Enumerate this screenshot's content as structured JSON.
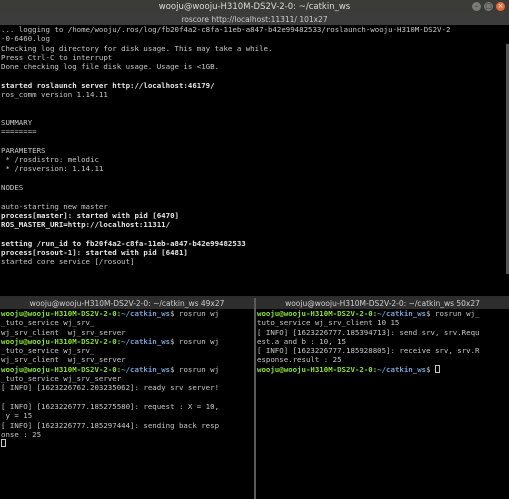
{
  "window_title": "wooju@wooju-H310M-DS2V-2-0: ~/catkin_ws",
  "window_controls": {
    "minimize": "–",
    "maximize": "□",
    "close": "×"
  },
  "top_pane": {
    "title": "roscore http://localhost:11311/ 101x27",
    "lines": [
      {
        "t": "... logging to /home/wooju/.ros/log/fb20f4a2-c8fa-11eb-a847-b42e99482533/roslaunch-wooju-H310M-DS2V-2"
      },
      {
        "t": "-0-6460.log"
      },
      {
        "t": "Checking log directory for disk usage. This may take a while."
      },
      {
        "t": "Press Ctrl-C to interrupt"
      },
      {
        "t": "Done checking log file disk usage. Usage is <1GB."
      },
      {
        "t": ""
      },
      {
        "t": "started roslaunch server http://localhost:46179/",
        "b": true
      },
      {
        "t": "ros_comm version 1.14.11"
      },
      {
        "t": ""
      },
      {
        "t": ""
      },
      {
        "t": "SUMMARY"
      },
      {
        "t": "========"
      },
      {
        "t": ""
      },
      {
        "t": "PARAMETERS"
      },
      {
        "t": " * /rosdistro: melodic"
      },
      {
        "t": " * /rosversion: 1.14.11"
      },
      {
        "t": ""
      },
      {
        "t": "NODES"
      },
      {
        "t": ""
      },
      {
        "t": "auto-starting new master"
      },
      {
        "t": "process[master]: started with pid [6470]",
        "b": true
      },
      {
        "t": "ROS_MASTER_URI=http://localhost:11311/",
        "b": true
      },
      {
        "t": ""
      },
      {
        "t": "setting /run_id to fb20f4a2-c8fa-11eb-a847-b42e99482533",
        "b": true
      },
      {
        "t": "process[rosout-1]: started with pid [6481]",
        "b": true
      },
      {
        "t": "started core service [/rosout]"
      }
    ]
  },
  "bottom_left_pane": {
    "title": "wooju@wooju-H310M-DS2V-2-0: ~/catkin_ws 49x27",
    "prompt_user": "wooju@wooju-H310M-DS2V-2-0",
    "prompt_path": "~/catkin_ws",
    "lines": [
      {
        "p": true,
        "t": " rosrun wj"
      },
      {
        "t": "_tuto_service wj_srv_"
      },
      {
        "t": "wj_srv_client  wj_srv_server"
      },
      {
        "p": true,
        "t": " rosrun wj"
      },
      {
        "t": "_tuto_service wj_srv_"
      },
      {
        "t": "wj_srv_client  wj_srv_server"
      },
      {
        "p": true,
        "t": " rosrun wj"
      },
      {
        "t": "_tuto_service wj_srv_server"
      },
      {
        "t": "[ INFO] [1623226762.203235062]: ready srv server!"
      },
      {
        "t": ""
      },
      {
        "t": "[ INFO] [1623226777.185275580]: request : X = 10,"
      },
      {
        "t": " y = 15"
      },
      {
        "t": "[ INFO] [1623226777.185297444]: sending back resp"
      },
      {
        "t": "onse : 25"
      },
      {
        "t": "",
        "cursor": true
      }
    ]
  },
  "bottom_right_pane": {
    "title": "wooju@wooju-H310M-DS2V-2-0: ~/catkin_ws 50x27",
    "prompt_user": "wooju@wooju-H310M-DS2V-2-0",
    "prompt_path": "~/catkin_ws",
    "lines": [
      {
        "p": true,
        "t": " rosrun wj_"
      },
      {
        "t": "tuto_service wj_srv_client 10 15"
      },
      {
        "t": "[ INFO] [1623226777.185394713]: send srv, srv.Requ"
      },
      {
        "t": "est.a and b : 10, 15"
      },
      {
        "t": "[ INFO] [1623226777.185928805]: receive srv, srv.R"
      },
      {
        "t": "esponse.result : 25"
      },
      {
        "p": true,
        "t": " ",
        "cursor": true
      }
    ]
  }
}
